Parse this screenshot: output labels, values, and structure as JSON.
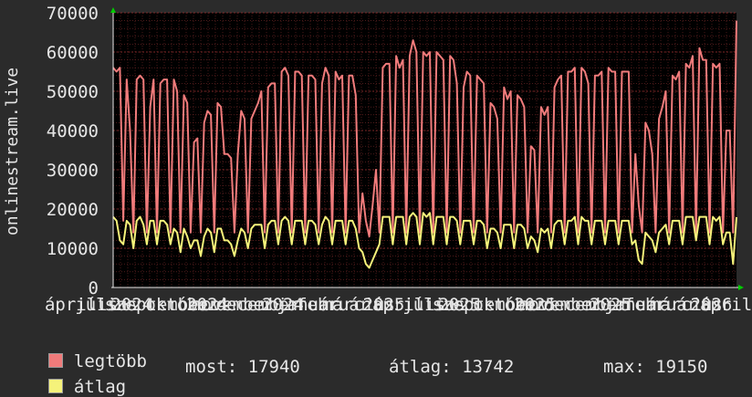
{
  "chart_data": {
    "type": "line",
    "ylabel": "onlinestream.live",
    "ylim": [
      0,
      70000
    ],
    "yticks": [
      0,
      10000,
      20000,
      30000,
      40000,
      50000,
      60000,
      70000
    ],
    "xtick_labels": [
      "április",
      "július",
      "2024",
      "szeptember",
      "október",
      "2024",
      "november",
      "december",
      "2024",
      "január",
      "február",
      "március",
      "2025",
      "április",
      "július",
      "2025",
      "szeptember",
      "október",
      "2025",
      "november",
      "december",
      "2025",
      "január",
      "február",
      "március",
      "2026",
      "április"
    ],
    "grid": true,
    "legend_placement": "bottom-left",
    "colors": {
      "legtobb": "#f07b7b",
      "atlag": "#f5f27a",
      "background": "#2b2b2b",
      "plot": "#000000",
      "grid": "#7a2a2a"
    },
    "series": [
      {
        "name": "legtöbb",
        "color": "#f07b7b",
        "values": [
          56000,
          55000,
          56000,
          17000,
          53000,
          40000,
          14000,
          53000,
          54000,
          53000,
          14000,
          46000,
          53000,
          14000,
          52000,
          53000,
          53000,
          14000,
          53000,
          50000,
          14000,
          49000,
          47000,
          14000,
          37000,
          38000,
          14000,
          42000,
          45000,
          44000,
          14000,
          47000,
          46000,
          34000,
          34000,
          33000,
          14000,
          34000,
          45000,
          43000,
          14000,
          43000,
          45000,
          47000,
          50000,
          14000,
          51000,
          52000,
          52000,
          14000,
          55000,
          56000,
          54000,
          14000,
          55000,
          55000,
          54000,
          14000,
          54000,
          54000,
          53000,
          14000,
          52000,
          56000,
          54000,
          14000,
          55000,
          53000,
          54000,
          14000,
          54000,
          54000,
          49000,
          14000,
          24000,
          17000,
          13000,
          21000,
          30000,
          14000,
          56000,
          57000,
          57000,
          14000,
          59000,
          56000,
          58000,
          14000,
          59000,
          63000,
          60000,
          14000,
          60000,
          59000,
          60000,
          14000,
          60000,
          59000,
          58000,
          14000,
          59000,
          58000,
          52000,
          14000,
          51000,
          55000,
          54000,
          14000,
          54000,
          53000,
          52000,
          14000,
          47000,
          46000,
          43000,
          14000,
          51000,
          48000,
          50000,
          14000,
          49000,
          48000,
          46000,
          14000,
          36000,
          35000,
          14000,
          46000,
          44000,
          46000,
          14000,
          51000,
          53000,
          54000,
          14000,
          55000,
          55000,
          56000,
          14000,
          56000,
          55000,
          52000,
          14000,
          54000,
          54000,
          55000,
          14000,
          56000,
          55000,
          55000,
          14000,
          55000,
          55000,
          55000,
          14000,
          34000,
          21000,
          14000,
          42000,
          40000,
          34000,
          14000,
          43000,
          46000,
          50000,
          14000,
          54000,
          53000,
          55000,
          14000,
          57000,
          56000,
          59000,
          14000,
          61000,
          58000,
          58000,
          14000,
          57000,
          56000,
          57000,
          14000,
          40000,
          40000,
          14000,
          68000
        ]
      },
      {
        "name": "átlag",
        "color": "#f5f27a",
        "values": [
          18000,
          17000,
          12000,
          11000,
          17000,
          16000,
          10000,
          17000,
          18000,
          16000,
          11000,
          17000,
          17000,
          11000,
          17000,
          17000,
          16000,
          11000,
          15000,
          14000,
          9000,
          15000,
          13000,
          10000,
          12000,
          12000,
          8000,
          13000,
          15000,
          14000,
          9000,
          15000,
          15000,
          12000,
          12000,
          11000,
          8000,
          12000,
          15000,
          14000,
          10000,
          15000,
          16000,
          16000,
          16000,
          10000,
          16000,
          17000,
          17000,
          11000,
          17000,
          18000,
          17000,
          11000,
          17000,
          17000,
          17000,
          11000,
          17000,
          17000,
          16000,
          11000,
          16000,
          18000,
          17000,
          11000,
          17000,
          17000,
          17000,
          11000,
          17000,
          17000,
          15000,
          10000,
          9000,
          6000,
          5000,
          7000,
          9000,
          11000,
          18000,
          18000,
          18000,
          11000,
          18000,
          18000,
          18000,
          11000,
          18000,
          19000,
          18000,
          11000,
          19000,
          18000,
          19000,
          11000,
          18000,
          18000,
          18000,
          11000,
          18000,
          18000,
          17000,
          11000,
          17000,
          17000,
          17000,
          11000,
          17000,
          17000,
          16000,
          10000,
          15000,
          15000,
          14000,
          10000,
          16000,
          16000,
          16000,
          10000,
          16000,
          16000,
          15000,
          10000,
          13000,
          12000,
          9000,
          15000,
          14000,
          15000,
          10000,
          16000,
          17000,
          17000,
          11000,
          17000,
          17000,
          18000,
          11000,
          18000,
          17000,
          17000,
          11000,
          17000,
          17000,
          17000,
          11000,
          17000,
          17000,
          17000,
          11000,
          17000,
          17000,
          17000,
          11000,
          12000,
          7000,
          6000,
          14000,
          13000,
          12000,
          9000,
          14000,
          15000,
          16000,
          11000,
          17000,
          17000,
          17000,
          11000,
          18000,
          18000,
          18000,
          12000,
          18000,
          18000,
          18000,
          11000,
          18000,
          17000,
          18000,
          11000,
          14000,
          14000,
          6000,
          17940
        ]
      }
    ]
  },
  "legend": [
    {
      "label": "legtöbb",
      "color": "#f07b7b"
    },
    {
      "label": "átlag",
      "color": "#f5f27a"
    }
  ],
  "stats": {
    "most": "most: 17940",
    "atlag": "átlag: 13742",
    "max": "max: 19150"
  }
}
